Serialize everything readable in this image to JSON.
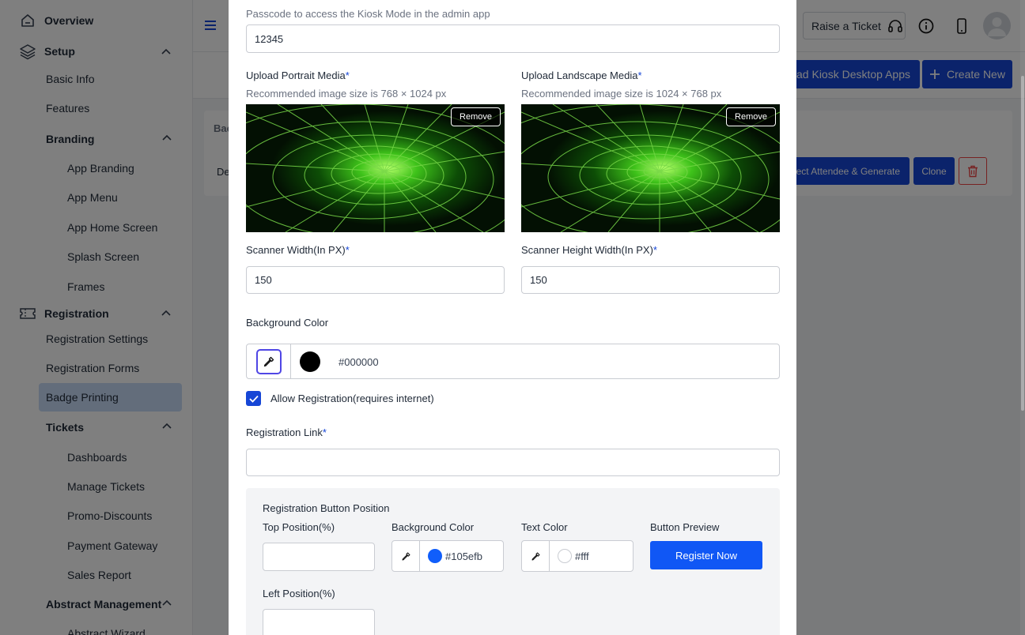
{
  "sidebar": {
    "overview": "Overview",
    "setup": "Setup",
    "basic_info": "Basic Info",
    "features": "Features",
    "branding": "Branding",
    "app_branding": "App Branding",
    "app_menu": "App Menu",
    "app_home_screen": "App Home Screen",
    "splash_screen": "Splash Screen",
    "frames": "Frames",
    "registration": "Registration",
    "registration_settings": "Registration Settings",
    "registration_forms": "Registration Forms",
    "badge_printing": "Badge Printing",
    "tickets": "Tickets",
    "dashboards": "Dashboards",
    "manage_tickets": "Manage Tickets",
    "promo_discounts": "Promo-Discounts",
    "payment_gateway": "Payment Gateway",
    "sales_report": "Sales Report",
    "abstract_management": "Abstract Management",
    "abstract_wizard": "Abstract Wizard"
  },
  "header": {
    "raise_ticket": "Raise a Ticket",
    "download_kiosk": "oad Kiosk Desktop Apps",
    "create_new": "Create New"
  },
  "table": {
    "col_head": "Bac",
    "row_text": "De",
    "select_generate": "lect Attendee & Generate",
    "clone": "Clone"
  },
  "modal": {
    "passcode_hint": "Passcode to access the Kiosk Mode in the admin app",
    "passcode_value": "12345",
    "portrait_label": "Upload Portrait Media",
    "portrait_hint": "Recommended image size is 768 × 1024 px",
    "landscape_label": "Upload Landscape Media",
    "landscape_hint": "Recommended image size is 1024 × 768 px",
    "remove": "Remove",
    "required_mark": "*",
    "scanner_width_label": "Scanner Width(In PX)",
    "scanner_width_value": "150",
    "scanner_height_label": "Scanner Height Width(In PX)",
    "scanner_height_value": "150",
    "bg_color_label": "Background Color",
    "bg_color_value": "#000000",
    "allow_registration": "Allow Registration(requires internet)",
    "allow_registration_checked": true,
    "registration_link_label": "Registration Link",
    "registration_link_value": "",
    "panel": {
      "title": "Registration Button Position",
      "top_position_label": "Top Position(%)",
      "top_position_value": "",
      "bg_color_label": "Background Color",
      "bg_color_value": "#105efb",
      "text_color_label": "Text Color",
      "text_color_value": "#fff",
      "button_preview_label": "Button Preview",
      "button_preview_text": "Register Now",
      "left_position_label": "Left Position(%)",
      "left_position_value": ""
    }
  },
  "colors": {
    "primary": "#1646d6",
    "preview_button": "#105efb",
    "active_nav": "#c7dbf7",
    "overlay": "rgba(0,0,0,0.5)"
  }
}
